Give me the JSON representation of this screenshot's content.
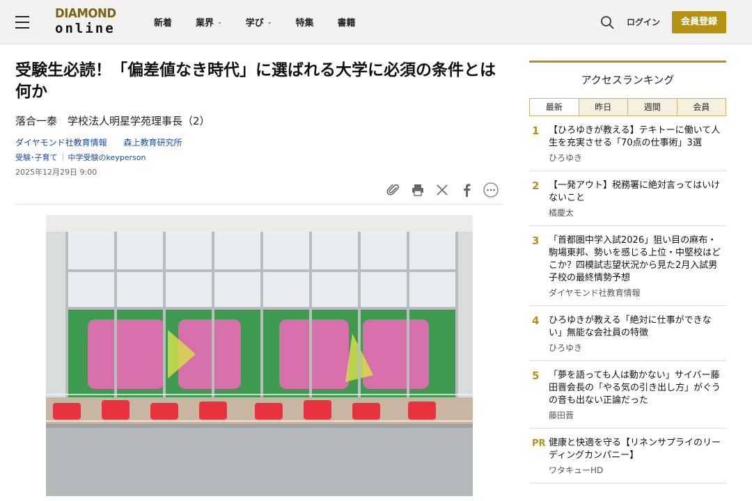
{
  "header": {
    "logo_line1": "DIAMOND",
    "logo_line2": "online",
    "nav": [
      {
        "label": "新着",
        "dropdown": false
      },
      {
        "label": "業界",
        "dropdown": true
      },
      {
        "label": "学び",
        "dropdown": true
      },
      {
        "label": "特集",
        "dropdown": false
      },
      {
        "label": "書籍",
        "dropdown": false
      }
    ],
    "login": "ログイン",
    "register": "会員登録",
    "accent_color": "#b59211"
  },
  "article": {
    "title": "受験生必読！「偏差値なき時代」に選ばれる大学に必須の条件とは何か",
    "subtitle": "落合一泰　学校法人明星学苑理事長（2）",
    "source": "ダイヤモンド社教育情報",
    "credit": "森上教育研究所",
    "tags": [
      "受験･子育て",
      "中学受験のkeyperson"
    ],
    "date": "2025年12月29日 9:00"
  },
  "sidebar": {
    "title": "アクセスランキング",
    "tabs": [
      "最新",
      "昨日",
      "週間",
      "会員"
    ],
    "items": [
      {
        "num": "1",
        "title": "【ひろゆきが教える】テキトーに働いて人生を充実させる「70点の仕事術」3選",
        "author": "ひろゆき"
      },
      {
        "num": "2",
        "title": "【一発アウト】税務署に絶対言ってはいけないこと",
        "author": "橘慶太"
      },
      {
        "num": "3",
        "title": "「首都圏中学入試2026」狙い目の麻布・駒場東邦、勢いを感じる上位・中堅校はどこか？四模試志望状況から見た2月入試男子校の最終情勢予想",
        "author": "ダイヤモンド社教育情報"
      },
      {
        "num": "4",
        "title": "ひろゆきが教える「絶対に仕事ができない」無能な会社員の特徴",
        "author": "ひろゆき"
      },
      {
        "num": "5",
        "title": "「夢を語っても人は動かない」サイバー藤田晋会長の「やる気の引き出し方」がぐうの音も出ない正論だった",
        "author": "藤田晋"
      }
    ],
    "pr": {
      "label": "PR",
      "title": "健康と快適を守る【リネンサプライのリーディングカンパニー】",
      "author": "ワタキューHD"
    }
  }
}
